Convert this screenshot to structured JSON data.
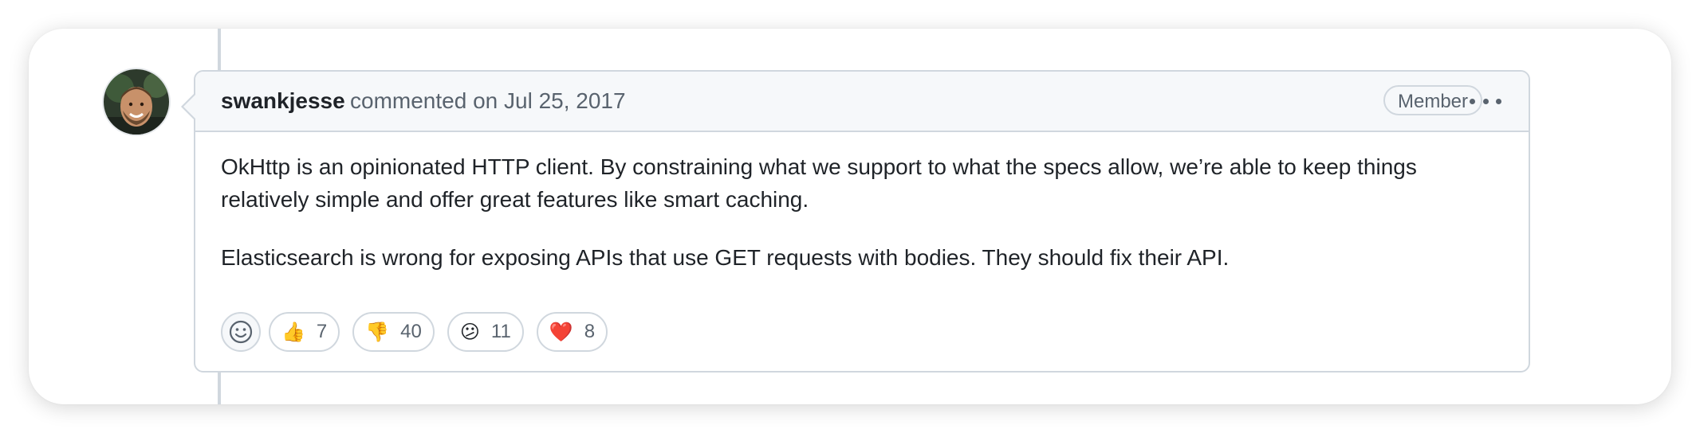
{
  "comment": {
    "author": "swankjesse",
    "meta": "commented on Jul 25, 2017",
    "badge": "Member",
    "paragraphs": [
      "OkHttp is an opinionated HTTP client. By constraining what we support to what the specs allow, we’re able to keep things relatively simple and offer great features like smart caching.",
      "Elasticsearch is wrong for exposing APIs that use GET requests with bodies. They should fix their API."
    ]
  },
  "reactions": [
    {
      "icon": "thumbs-up-icon",
      "emoji": "👍",
      "count": "7"
    },
    {
      "icon": "thumbs-down-icon",
      "emoji": "👎",
      "count": "40"
    },
    {
      "icon": "confused-face-icon",
      "emoji": "😕",
      "count": "11"
    },
    {
      "icon": "heart-icon",
      "emoji": "❤️",
      "count": "8"
    }
  ],
  "colors": {
    "border": "#d0d7de",
    "header_bg": "#f6f8fa",
    "text": "#1f2328",
    "muted": "#59636e",
    "heart": "#e0245e"
  }
}
